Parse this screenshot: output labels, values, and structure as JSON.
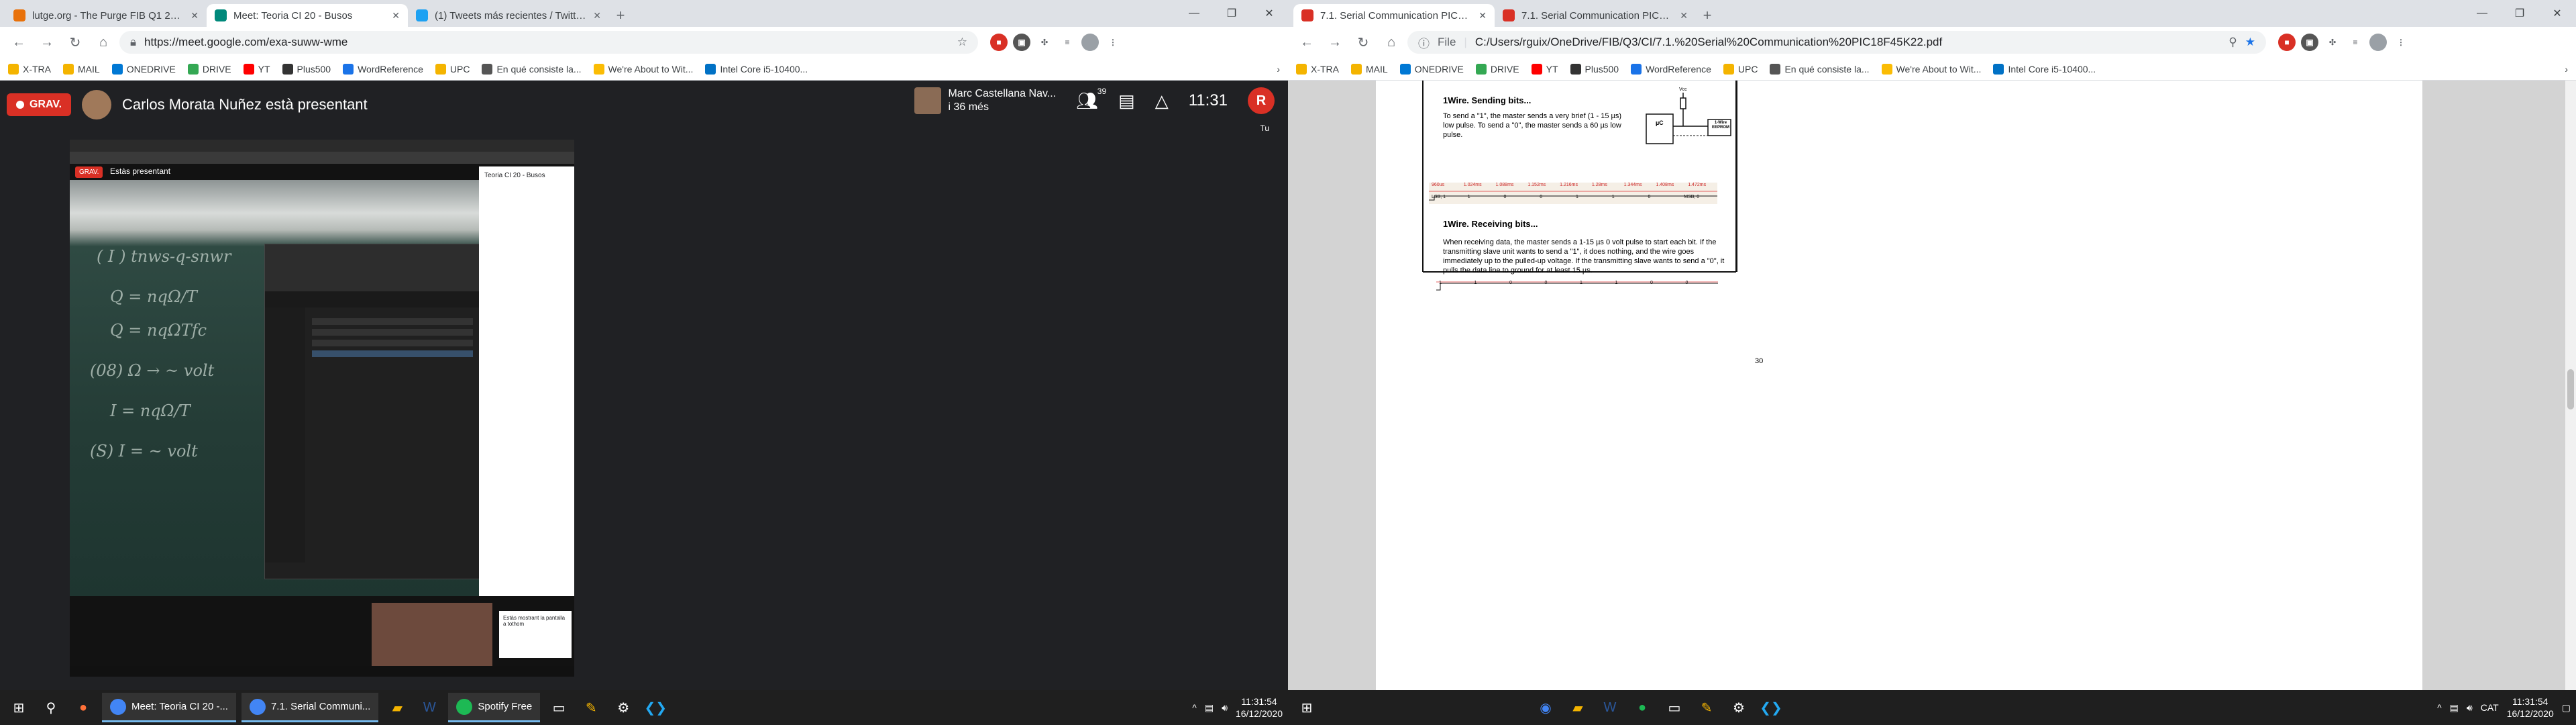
{
  "left": {
    "tabs": [
      {
        "title": "lutge.org - The Purge FIB Q1 20...",
        "color": "#e8710a",
        "active": false
      },
      {
        "title": "Meet: Teoria CI 20 - Busos",
        "color": "#00897b",
        "active": true
      },
      {
        "title": "(1) Tweets más recientes / Twitte...",
        "color": "#1da1f2",
        "active": false
      }
    ],
    "url": "https://meet.google.com/exa-suww-wme",
    "bookmarks": [
      "X-TRA",
      "MAIL",
      "ONEDRIVE",
      "DRIVE",
      "YT",
      "Plus500",
      "WordReference",
      "UPC",
      "En qué consiste la...",
      "We're About to Wit...",
      "Intel Core i5-10400..."
    ],
    "meet": {
      "recording_label": "GRAV.",
      "presenter_title": "Carlos Morata Nuñez està presentant",
      "participant_name": "Marc Castellana Nav...",
      "participant_sub": "i 36 més",
      "participants_count": "39",
      "time": "11:31",
      "self_initial": "R",
      "self_label": "Tu",
      "inner_presenting": "Estàs presentant",
      "inner_panel_title": "Teoria CI 20 - Busos",
      "share_banner": "Estàs mostrant la pantalla a tothom"
    },
    "chalk_lines": [
      "( I ) tnws-q-snwr",
      "Q = nqΩ/T",
      "Q = nqΩTfc",
      "(08) Ω → ~ volt",
      "I = nqΩ/T",
      "(S) I = ~ volt"
    ],
    "taskbar": {
      "apps": [
        "Meet: Teoria CI 20 -...",
        "7.1. Serial Communi...",
        "Spotify Free"
      ],
      "time": "11:31:54",
      "date": "16/12/2020"
    }
  },
  "right": {
    "tabs": [
      {
        "title": "7.1. Serial Communication PIC18...",
        "active": true
      },
      {
        "title": "7.1. Serial Communication PIC18...",
        "active": false
      }
    ],
    "url_scheme": "File",
    "url": "C:/Users/rguix/OneDrive/FIB/Q3/CI/7.1.%20Serial%20Communication%20PIC18F45K22.pdf",
    "bookmarks": [
      "X-TRA",
      "MAIL",
      "ONEDRIVE",
      "DRIVE",
      "YT",
      "Plus500",
      "WordReference",
      "UPC",
      "En qué consiste la...",
      "We're About to Wit...",
      "Intel Core i5-10400..."
    ],
    "pdf": {
      "sending_title": "1Wire. Sending bits...",
      "sending_text": "To send a \"1\", the master sends a very brief (1 - 15 µs) low pulse. To send a \"0\", the master sends a 60 µs low pulse.",
      "vcc_label": "Vcc",
      "uc_label": "µC",
      "eeprom_label": "1-Wire EEPROM",
      "timeline_labels": [
        "960us",
        "1.024ms",
        "1.088ms",
        "1.152ms",
        "1.216ms",
        "1.28ms",
        "1.344ms",
        "1.408ms",
        "1.472ms"
      ],
      "sending_bits": [
        "LSB, 1",
        "1",
        "0",
        "0",
        "1",
        "1",
        "0",
        "MSB, 0"
      ],
      "receiving_title": "1Wire. Receiving bits...",
      "receiving_text": "When receiving data, the master sends a 1-15 µs 0 volt pulse to start each bit. If the transmitting slave unit wants to send a \"1\", it does nothing, and the wire goes immediately up to the pulled-up voltage. If the transmitting slave wants to send a \"0\", it pulls the data line to ground for at least 15 µs.",
      "receiving_bits": [
        "1",
        "1",
        "0",
        "0",
        "1",
        "1",
        "0",
        "0"
      ],
      "page_number": "30"
    },
    "taskbar": {
      "time": "11:31:54",
      "date": "16/12/2020",
      "lang": "CAT"
    }
  }
}
